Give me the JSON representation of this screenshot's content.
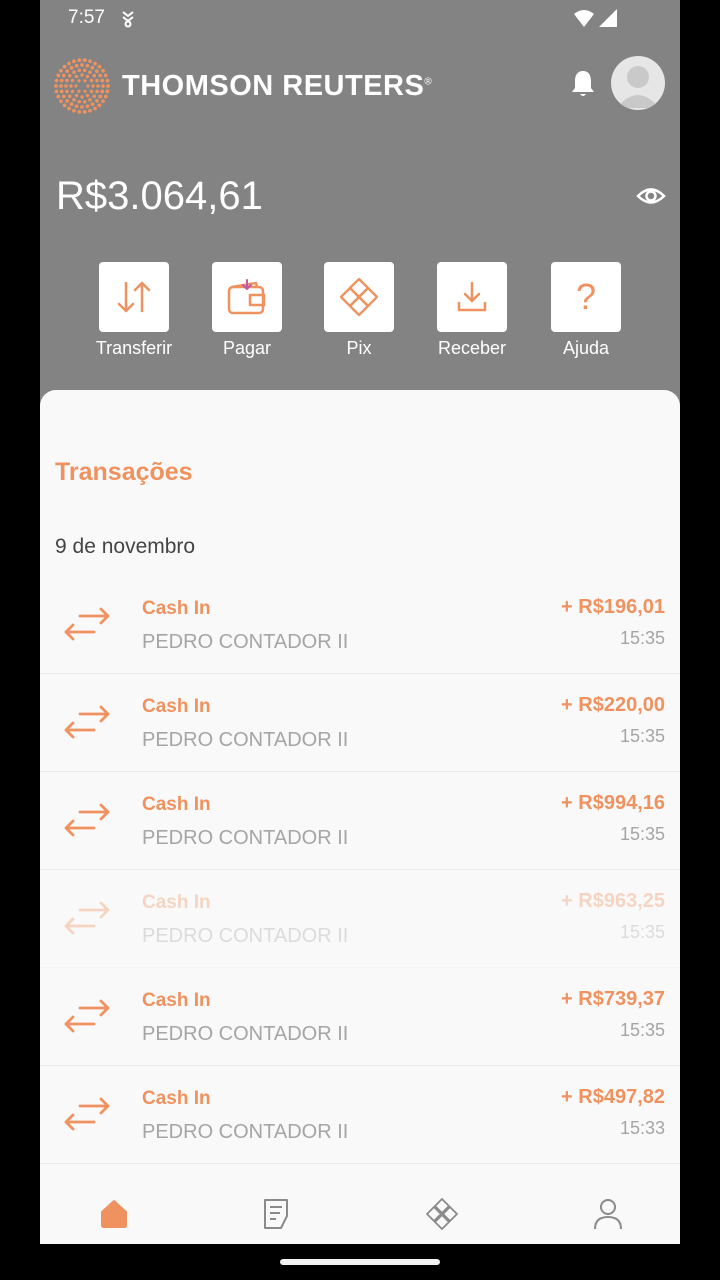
{
  "status_bar": {
    "time": "7:57"
  },
  "brand": {
    "name": "THOMSON REUTERS",
    "mark": "®"
  },
  "account": {
    "balance": "R$3.064,61"
  },
  "actions": [
    {
      "label": "Transferir",
      "icon": "transfer-arrows-icon"
    },
    {
      "label": "Pagar",
      "icon": "wallet-icon"
    },
    {
      "label": "Pix",
      "icon": "pix-icon"
    },
    {
      "label": "Receber",
      "icon": "download-icon"
    },
    {
      "label": "Ajuda",
      "icon": "help-icon"
    }
  ],
  "transactions": {
    "title": "Transações",
    "date": "9 de novembro",
    "items": [
      {
        "type": "Cash In",
        "party": "PEDRO CONTADOR II",
        "amount": "+ R$196,01",
        "time": "15:35"
      },
      {
        "type": "Cash In",
        "party": "PEDRO CONTADOR II",
        "amount": "+ R$220,00",
        "time": "15:35"
      },
      {
        "type": "Cash In",
        "party": "PEDRO CONTADOR II",
        "amount": "+ R$994,16",
        "time": "15:35"
      },
      {
        "type": "Cash In",
        "party": "PEDRO CONTADOR II",
        "amount": "+ R$963,25",
        "time": "15:35"
      },
      {
        "type": "Cash In",
        "party": "PEDRO CONTADOR II",
        "amount": "+ R$739,37",
        "time": "15:35"
      },
      {
        "type": "Cash In",
        "party": "PEDRO CONTADOR II",
        "amount": "+ R$497,82",
        "time": "15:33"
      }
    ]
  },
  "colors": {
    "accent": "#ef925f",
    "header_bg": "#838383",
    "muted_text": "#a5a5a5"
  }
}
